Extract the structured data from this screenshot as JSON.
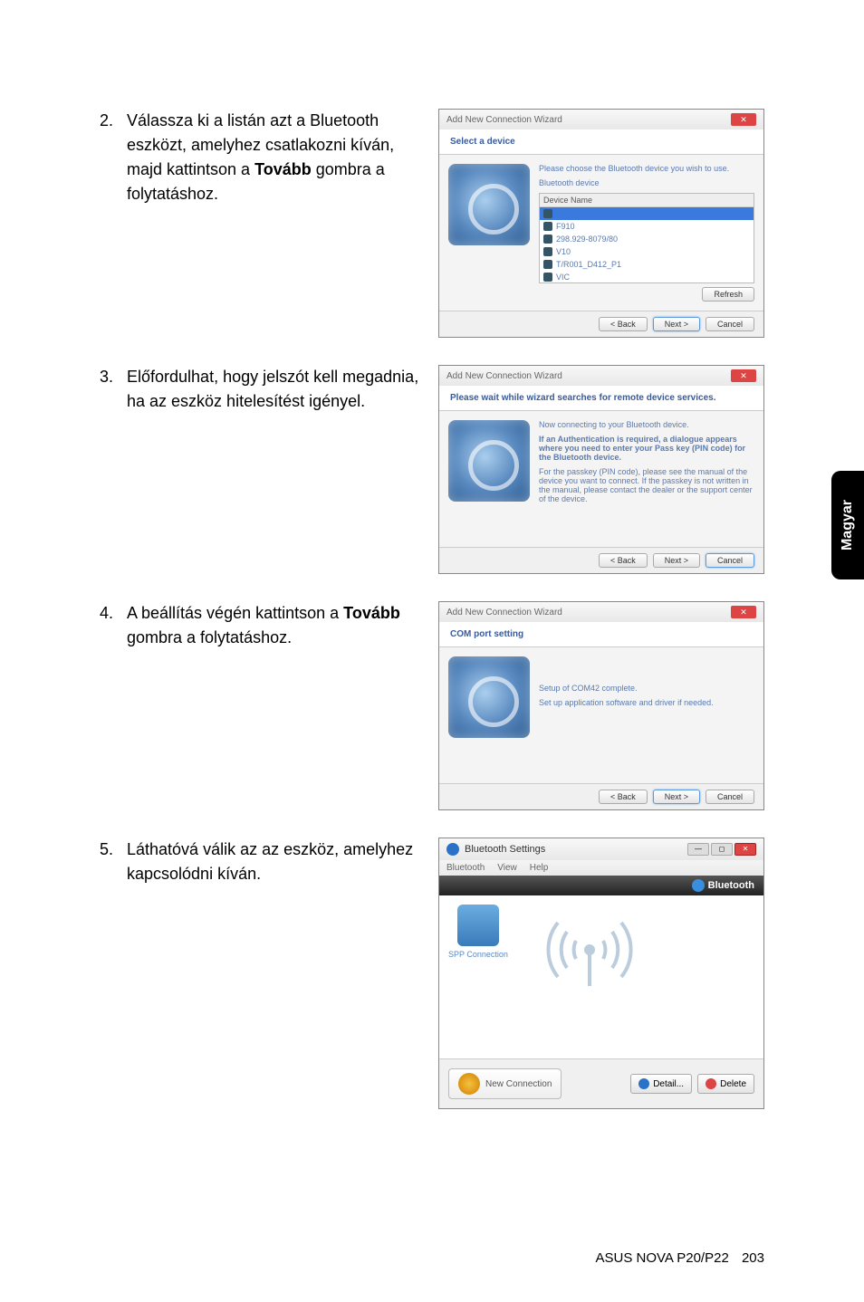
{
  "side_tab": "Magyar",
  "footer": {
    "model": "ASUS NOVA P20/P22",
    "page": "203"
  },
  "steps": [
    {
      "num": "2.",
      "text_parts": [
        "Válassza ki a listán azt a Bluetooth eszközt, amelyhez csatlakozni kíván, majd kattintson a ",
        "Tovább",
        " gombra a folytatáshoz."
      ]
    },
    {
      "num": "3.",
      "text_parts": [
        "Előfordulhat, hogy jelszót kell megadnia, ha az eszköz hitelesítést igényel."
      ]
    },
    {
      "num": "4.",
      "text_parts": [
        "A beállítás végén kattintson a ",
        "Tovább",
        " gombra a folytatáshoz."
      ]
    },
    {
      "num": "5.",
      "text_parts": [
        "Láthatóvá válik az az eszköz, amelyhez kapcsolódni kíván."
      ]
    }
  ],
  "wizard1": {
    "title": "Add New Connection Wizard",
    "header": "Select a device",
    "prompt": "Please choose the Bluetooth device you wish to use.",
    "section_label": "Bluetooth device",
    "col_header": "Device Name",
    "devices": [
      "",
      "F910",
      "298.929-8079/80",
      "V10",
      "T/R001_D412_P1",
      "VIC"
    ],
    "refresh": "Refresh",
    "back": "< Back",
    "next": "Next >",
    "cancel": "Cancel"
  },
  "wizard2": {
    "title": "Add New Connection Wizard",
    "header": "Please wait while wizard searches for remote device services.",
    "line1": "Now connecting to your Bluetooth device.",
    "line2": "If an Authentication is required, a dialogue appears where you need to enter your Pass key (PIN code) for the Bluetooth device.",
    "line3": "For the passkey (PIN code), please see the manual of the device you want to connect. If the passkey is not written in the manual, please contact the dealer or the support center of the device.",
    "back": "< Back",
    "next": "Next >",
    "cancel": "Cancel"
  },
  "wizard3": {
    "title": "Add New Connection Wizard",
    "header": "COM port setting",
    "line1": "Setup of COM42 complete.",
    "line2": "Set up application software and driver if needed.",
    "back": "< Back",
    "next": "Next >",
    "cancel": "Cancel"
  },
  "bt_settings": {
    "title": "Bluetooth Settings",
    "menu": [
      "Bluetooth",
      "View",
      "Help"
    ],
    "brand": "Bluetooth",
    "device_label": "SPP Connection",
    "new_connection": "New Connection",
    "detail": "Detail...",
    "delete": "Delete"
  }
}
